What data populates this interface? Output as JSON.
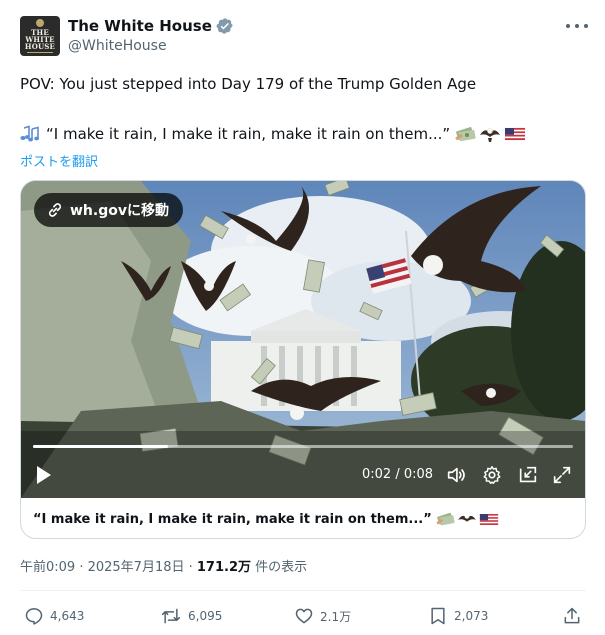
{
  "author": {
    "display_name": "The White House",
    "handle": "@WhiteHouse",
    "avatar_lines": [
      "THE",
      "WHITE",
      "HOUSE"
    ]
  },
  "tweet": {
    "line1": "POV: You just stepped into Day 179 of the Trump Golden Age",
    "line2": "“I make it rain, I make it rain, make it rain on them...”",
    "translate_label": "ポストを翻訳"
  },
  "card": {
    "link_label": "wh.govに移動",
    "time_display": "0:02 / 0:08",
    "progress": 0.25,
    "caption": "“I make it rain, I make it rain, make it rain on them...”"
  },
  "meta": {
    "timestamp": "午前0:09 · 2025年7月18日 · ",
    "views_count": "171.2万",
    "views_label": " 件の表示"
  },
  "actions": {
    "replies": "4,643",
    "reposts": "6,095",
    "likes": "2.1万",
    "bookmarks": "2,073"
  },
  "icons": [
    "verified-badge-icon",
    "more-icon",
    "music-notes-icon",
    "money-icon",
    "eagle-icon",
    "us-flag-icon",
    "link-icon",
    "play-icon",
    "volume-icon",
    "settings-icon",
    "pip-icon",
    "fullscreen-icon",
    "reply-icon",
    "repost-icon",
    "like-icon",
    "bookmark-icon",
    "share-icon"
  ],
  "colors": {
    "accent": "#1d9bf0",
    "text": "#0f1419",
    "secondary": "#536471",
    "border": "#cfd9de"
  }
}
